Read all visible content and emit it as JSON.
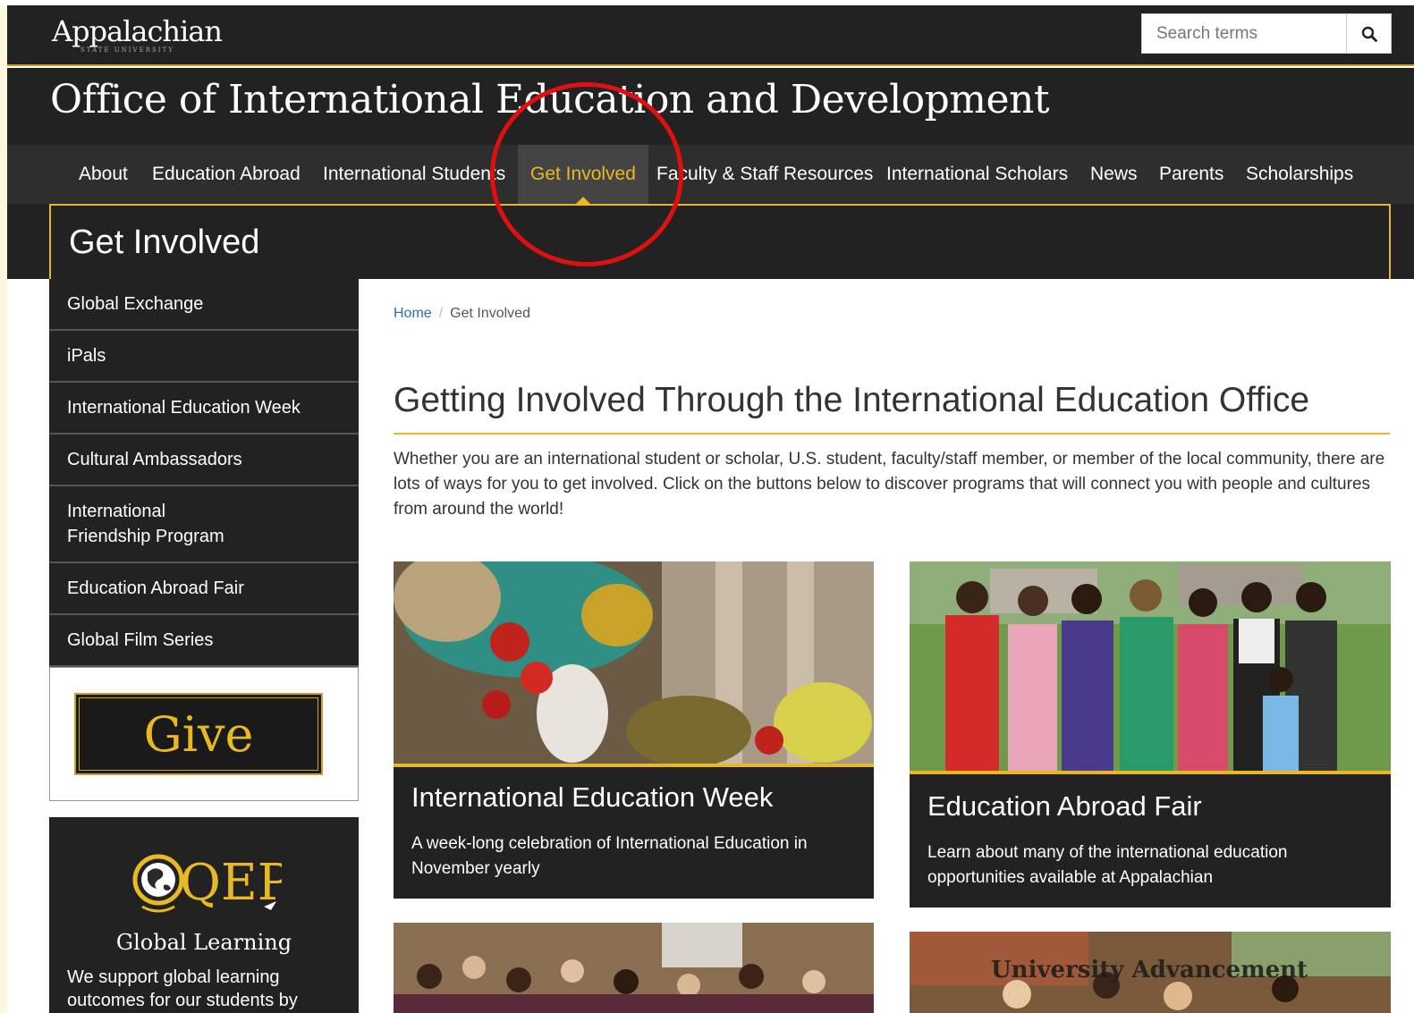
{
  "header": {
    "logo_text": "Appalachian",
    "logo_sub": "STATE UNIVERSITY",
    "search_placeholder": "Search terms",
    "site_title": "Office of International Education and Development"
  },
  "nav": {
    "items": [
      "About",
      "Education Abroad",
      "International Students",
      "Get Involved",
      "Faculty & Staff Resources",
      "International Scholars",
      "News",
      "Parents",
      "Scholarships"
    ],
    "active": "Get Involved"
  },
  "page_heading": "Get Involved",
  "sidebar": {
    "items": [
      "Global Exchange",
      "iPals",
      "International Education Week",
      "Cultural Ambassadors",
      "International Friendship Program",
      "Education Abroad Fair",
      "Global Film Series"
    ]
  },
  "give": {
    "label": "Give"
  },
  "qep": {
    "logo_text": "QEP",
    "subtitle": "Global Learning",
    "text": "We support global learning outcomes for our students by"
  },
  "breadcrumb": {
    "home": "Home",
    "separator": "/",
    "current": "Get Involved"
  },
  "main": {
    "title": "Getting Involved Through the International Education Office",
    "intro": "Whether you are an international student or scholar, U.S. student, faculty/staff member, or member of the local community, there are lots of ways for you to get involved. Click on the buttons below to discover programs that will connect you with people and cultures from around the world!"
  },
  "cards": [
    {
      "title": "International Education Week",
      "description": "A week-long celebration of International Education in November yearly"
    },
    {
      "title": "Education Abroad Fair",
      "description": "Learn about many of the international education opportunities available at Appalachian"
    }
  ],
  "watermark": "University Advancement",
  "colors": {
    "dark": "#222222",
    "gold": "#e8b923",
    "link": "#2a6fb0",
    "annotation": "#e01010"
  }
}
